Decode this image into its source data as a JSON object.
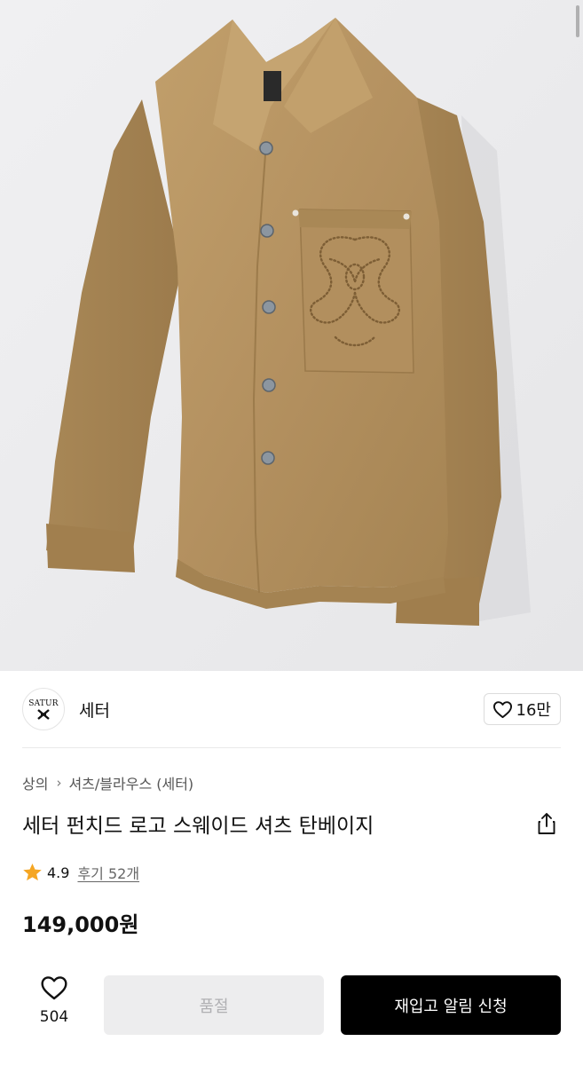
{
  "product_image": {
    "alt": "세터 펀치드 로고 스웨이드 셔츠 탄베이지",
    "background_color": "#ececee",
    "garment_color": "#b79564"
  },
  "brand": {
    "logo_text": "SATUR",
    "name": "세터",
    "like_icon": "heart-outline-icon",
    "like_count": "16만"
  },
  "breadcrumb": {
    "category": "상의",
    "separator_icon": "chevron-right-icon",
    "subcategory": "셔츠/블라우스 (세터)"
  },
  "product": {
    "title": "세터 펀치드 로고 스웨이드 셔츠 탄베이지",
    "share_icon": "share-icon",
    "rating_icon": "star-icon",
    "rating_color": "#f5a623",
    "rating": "4.9",
    "reviews_label": "후기 52개",
    "price": "149,000원"
  },
  "bottom_bar": {
    "wish_icon": "heart-outline-icon",
    "wish_count": "504",
    "soldout_label": "품절",
    "restock_label": "재입고 알림 신청",
    "restock_color": "#000000"
  }
}
